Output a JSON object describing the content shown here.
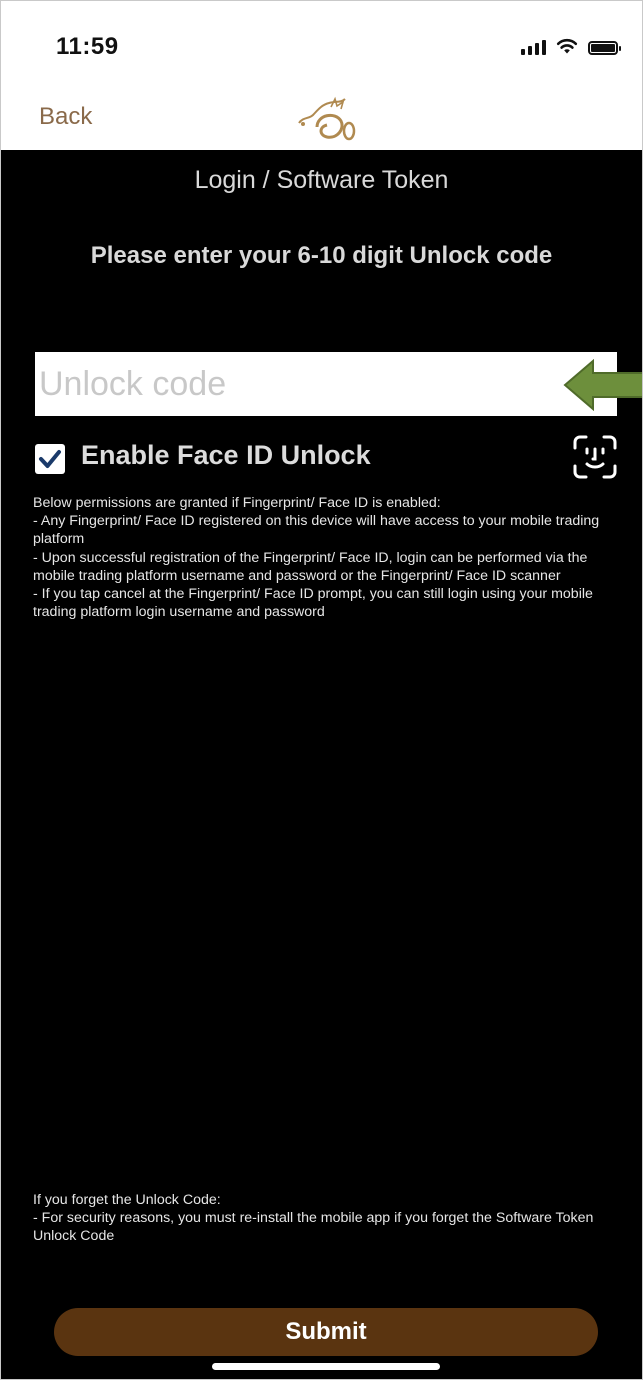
{
  "status_bar": {
    "time": "11:59"
  },
  "nav": {
    "back_label": "Back",
    "logo_icon": "dragon-logo-icon"
  },
  "page": {
    "title": "Login / Software Token",
    "instruction": "Please enter your 6-10 digit Unlock code"
  },
  "unlock_input": {
    "value": "",
    "placeholder": "Unlock code"
  },
  "face_id": {
    "checked": true,
    "label": "Enable Face ID Unlock",
    "icon": "face-id-icon"
  },
  "permissions": {
    "lines": [
      "Below permissions are granted if Fingerprint/ Face ID is enabled:",
      "- Any Fingerprint/ Face ID registered on this device will have access to your mobile trading platform",
      "- Upon successful registration of the Fingerprint/ Face ID, login can be performed via the mobile trading platform username and password or the Fingerprint/ Face ID scanner",
      "- If you tap cancel at the Fingerprint/ Face ID prompt, you can still login using your mobile trading platform login username and password"
    ]
  },
  "forget_note": {
    "lines": [
      "If you forget the Unlock Code:",
      "- For security reasons, you must re-install the mobile app if you forget the Software Token Unlock Code"
    ]
  },
  "submit": {
    "label": "Submit"
  },
  "colors": {
    "accent_brown": "#5a3410",
    "back_text": "#8a6a4a",
    "arrow_green": "#6d8f3c"
  }
}
